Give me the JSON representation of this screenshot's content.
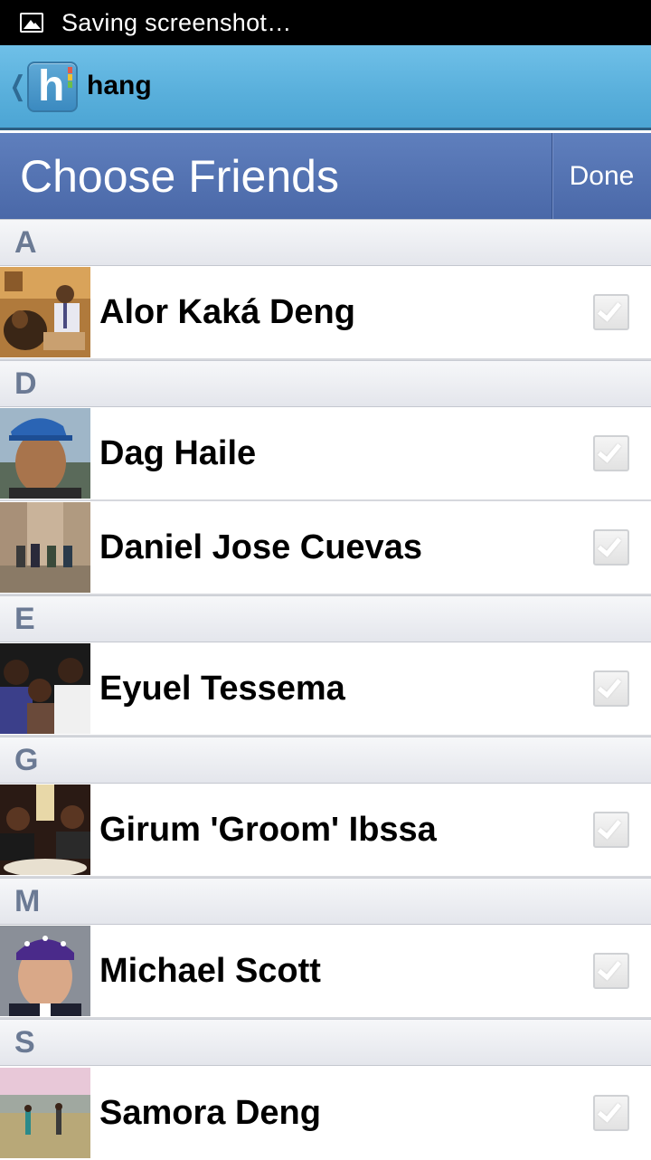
{
  "status_bar": {
    "notification_icon": "image-icon",
    "text": "Saving screenshot…"
  },
  "app_header": {
    "back_icon": "chevron-left-icon",
    "logo_letter": "h",
    "title": "hang",
    "colors": {
      "bar": "#5ab0dc",
      "logo": "#3b8ac0"
    }
  },
  "choose_bar": {
    "title": "Choose Friends",
    "done_label": "Done",
    "colors": {
      "bar": "#4f6eab"
    }
  },
  "sections": [
    {
      "letter": "A",
      "friends": [
        {
          "name": "Alor Kaká Deng",
          "avatar": "photo-man-with-dog",
          "checked": true
        }
      ]
    },
    {
      "letter": "D",
      "friends": [
        {
          "name": "Dag Haile",
          "avatar": "photo-man-blue-cap",
          "checked": true
        },
        {
          "name": "Daniel Jose Cuevas",
          "avatar": "photo-group-outdoors",
          "checked": true
        }
      ]
    },
    {
      "letter": "E",
      "friends": [
        {
          "name": "Eyuel Tessema",
          "avatar": "photo-three-friends",
          "checked": true
        }
      ]
    },
    {
      "letter": "G",
      "friends": [
        {
          "name": "Girum 'Groom' Ibssa",
          "avatar": "photo-dinner-friends",
          "checked": true
        }
      ]
    },
    {
      "letter": "M",
      "friends": [
        {
          "name": "Michael Scott",
          "avatar": "photo-man-bandana",
          "checked": true
        }
      ]
    },
    {
      "letter": "S",
      "friends": [
        {
          "name": "Samora Deng",
          "avatar": "photo-field-people",
          "checked": true
        }
      ]
    }
  ]
}
